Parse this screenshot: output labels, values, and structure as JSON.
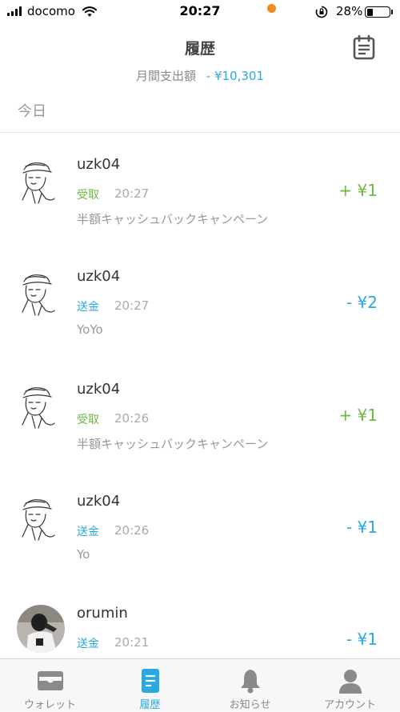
{
  "status_bar": {
    "carrier": "docomo",
    "time": "20:27",
    "battery": "28%",
    "battery_level": 0.28
  },
  "header": {
    "title": "履歴",
    "monthly_label": "月間支出額",
    "monthly_value": "- ¥10,301",
    "calendar_icon": "calendar-icon"
  },
  "section": {
    "label": "今日"
  },
  "transactions": [
    {
      "name": "uzk04",
      "type": "受取",
      "time": "20:27",
      "memo": "半額キャッシュバックキャンペーン",
      "amount": "+ ¥1"
    },
    {
      "name": "uzk04",
      "type": "送金",
      "time": "20:27",
      "memo": "YoYo",
      "amount": "- ¥2"
    },
    {
      "name": "uzk04",
      "type": "受取",
      "time": "20:26",
      "memo": "半額キャッシュバックキャンペーン",
      "amount": "+ ¥1"
    },
    {
      "name": "uzk04",
      "type": "送金",
      "time": "20:26",
      "memo": "Yo",
      "amount": "- ¥1"
    },
    {
      "name": "orumin",
      "type": "送金",
      "time": "20:21",
      "memo": "",
      "amount": "- ¥1"
    }
  ],
  "tabs": [
    {
      "label": "ウォレット",
      "icon": "wallet-icon"
    },
    {
      "label": "履歴",
      "icon": "history-icon"
    },
    {
      "label": "お知らせ",
      "icon": "bell-icon"
    },
    {
      "label": "アカウント",
      "icon": "account-icon"
    }
  ],
  "colors": {
    "accent": "#2aa9e0",
    "received": "#6cb840",
    "badge": "#f08a1c"
  }
}
